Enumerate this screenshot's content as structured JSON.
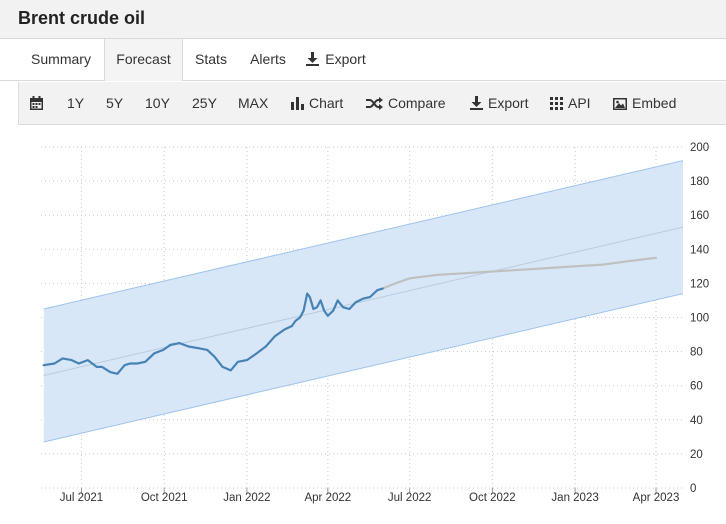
{
  "header": {
    "title": "Brent crude oil"
  },
  "tabs": [
    {
      "label": "Summary",
      "active": false
    },
    {
      "label": "Forecast",
      "active": true
    },
    {
      "label": "Stats",
      "active": false
    },
    {
      "label": "Alerts",
      "active": false
    },
    {
      "label": "Export",
      "active": false,
      "icon": "download-icon"
    }
  ],
  "toolbar": {
    "calendar_icon": "calendar-icon",
    "ranges": [
      "1Y",
      "5Y",
      "10Y",
      "25Y",
      "MAX"
    ],
    "chart_label": "Chart",
    "compare_label": "Compare",
    "export_label": "Export",
    "api_label": "API",
    "embed_label": "Embed"
  },
  "colors": {
    "series": "#4682b4",
    "forecast": "#c0c0c0",
    "band_fill": "#d6e6f8",
    "band_edge": "#9dc3ee",
    "trend": "#b8cbe0"
  },
  "chart_data": {
    "type": "line",
    "x_axis": {
      "type": "date",
      "range": [
        "2021-05-17",
        "2023-05-01"
      ],
      "ticks": [
        "Jul 2021",
        "Oct 2021",
        "Jan 2022",
        "Apr 2022",
        "Jul 2022",
        "Oct 2022",
        "Jan 2023",
        "Apr 2023"
      ]
    },
    "y_axis": {
      "range": [
        0,
        200
      ],
      "ticks": [
        0,
        20,
        40,
        60,
        80,
        100,
        120,
        140,
        160,
        180,
        200
      ],
      "position": "right"
    },
    "grid": true,
    "legend": "none",
    "series": [
      {
        "style": "historical",
        "x": [
          "2021-05-20",
          "2021-06-01",
          "2021-06-10",
          "2021-06-20",
          "2021-06-28",
          "2021-07-08",
          "2021-07-18",
          "2021-07-24",
          "2021-08-02",
          "2021-08-10",
          "2021-08-18",
          "2021-08-24",
          "2021-09-01",
          "2021-09-10",
          "2021-09-20",
          "2021-09-30",
          "2021-10-08",
          "2021-10-18",
          "2021-10-28",
          "2021-11-08",
          "2021-11-18",
          "2021-11-26",
          "2021-12-05",
          "2021-12-14",
          "2021-12-22",
          "2022-01-01",
          "2022-01-12",
          "2022-01-22",
          "2022-02-01",
          "2022-02-12",
          "2022-02-20",
          "2022-02-24",
          "2022-03-01",
          "2022-03-05",
          "2022-03-09",
          "2022-03-12",
          "2022-03-16",
          "2022-03-20",
          "2022-03-24",
          "2022-03-28",
          "2022-04-01",
          "2022-04-07",
          "2022-04-12",
          "2022-04-18",
          "2022-04-25",
          "2022-05-02",
          "2022-05-10",
          "2022-05-18",
          "2022-05-26",
          "2022-06-01"
        ],
        "y": [
          72,
          73,
          76,
          75,
          73,
          75,
          71,
          71,
          68,
          67,
          72,
          73,
          73,
          74,
          79,
          81,
          84,
          85,
          83,
          82,
          81,
          77,
          71,
          69,
          74,
          75,
          79,
          83,
          89,
          93,
          95,
          98,
          100,
          104,
          114,
          112,
          105,
          106,
          110,
          104,
          101,
          104,
          110,
          106,
          105,
          109,
          111,
          112,
          116,
          117
        ]
      },
      {
        "style": "forecast",
        "x": [
          "2022-06-01",
          "2022-06-15",
          "2022-07-01",
          "2022-08-01",
          "2022-09-01",
          "2022-10-01",
          "2022-11-01",
          "2022-12-01",
          "2023-01-01",
          "2023-02-01",
          "2023-03-01",
          "2023-04-01"
        ],
        "y": [
          117,
          120,
          123,
          125,
          126,
          127,
          128,
          129,
          130,
          131,
          133,
          135
        ]
      },
      {
        "style": "trend",
        "x": [
          "2021-05-20",
          "2023-05-01"
        ],
        "y": [
          66,
          153
        ]
      },
      {
        "style": "band-upper",
        "x": [
          "2021-05-20",
          "2023-05-01"
        ],
        "y": [
          105,
          192
        ]
      },
      {
        "style": "band-lower",
        "x": [
          "2021-05-20",
          "2023-05-01"
        ],
        "y": [
          27,
          114
        ]
      }
    ]
  }
}
